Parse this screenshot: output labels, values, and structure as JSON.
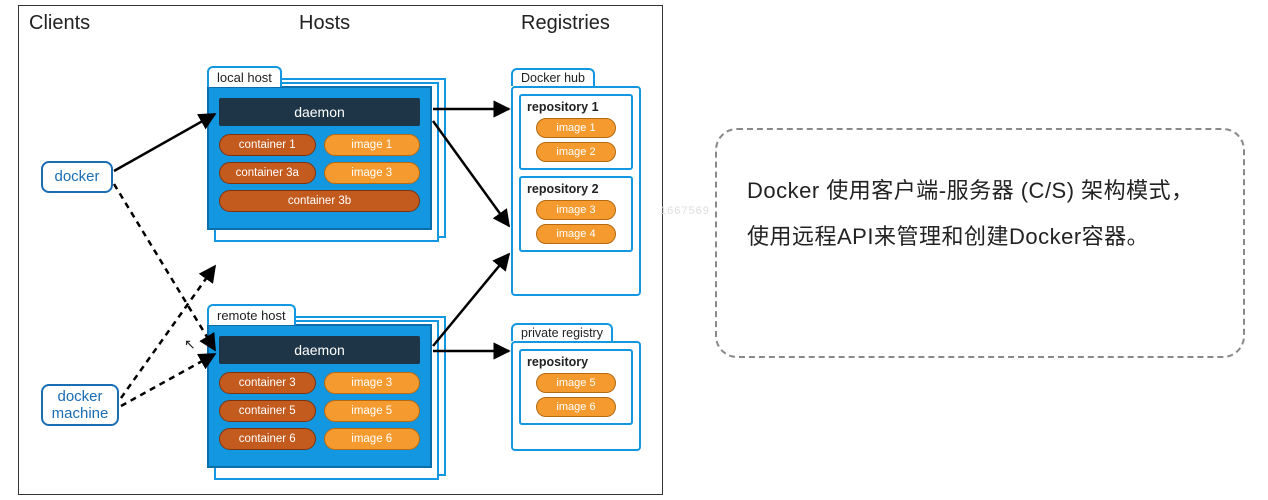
{
  "headers": {
    "clients": "Clients",
    "hosts": "Hosts",
    "registries": "Registries"
  },
  "clients": {
    "docker": "docker",
    "docker_machine": "docker\nmachine"
  },
  "hosts": {
    "local": {
      "label": "local host",
      "daemon": "daemon",
      "rows": [
        [
          "container 1",
          "image 1"
        ],
        [
          "container 3a",
          "image 3"
        ],
        [
          "container 3b",
          ""
        ]
      ]
    },
    "remote": {
      "label": "remote host",
      "daemon": "daemon",
      "rows": [
        [
          "container 3",
          "image 3"
        ],
        [
          "container 5",
          "image 5"
        ],
        [
          "container 6",
          "image 6"
        ]
      ]
    }
  },
  "registries": {
    "docker_hub": {
      "label": "Docker hub",
      "repos": [
        {
          "name": "repository 1",
          "images": [
            "image 1",
            "image 2"
          ]
        },
        {
          "name": "repository 2",
          "images": [
            "image 3",
            "image 4"
          ]
        }
      ]
    },
    "private": {
      "label": "private registry",
      "repos": [
        {
          "name": "repository",
          "images": [
            "image 5",
            "image 6"
          ]
        }
      ]
    }
  },
  "note": "Docker 使用客户端-服务器 (C/S) 架构模式，使用远程API来管理和创建Docker容器。",
  "watermark": "1667569"
}
